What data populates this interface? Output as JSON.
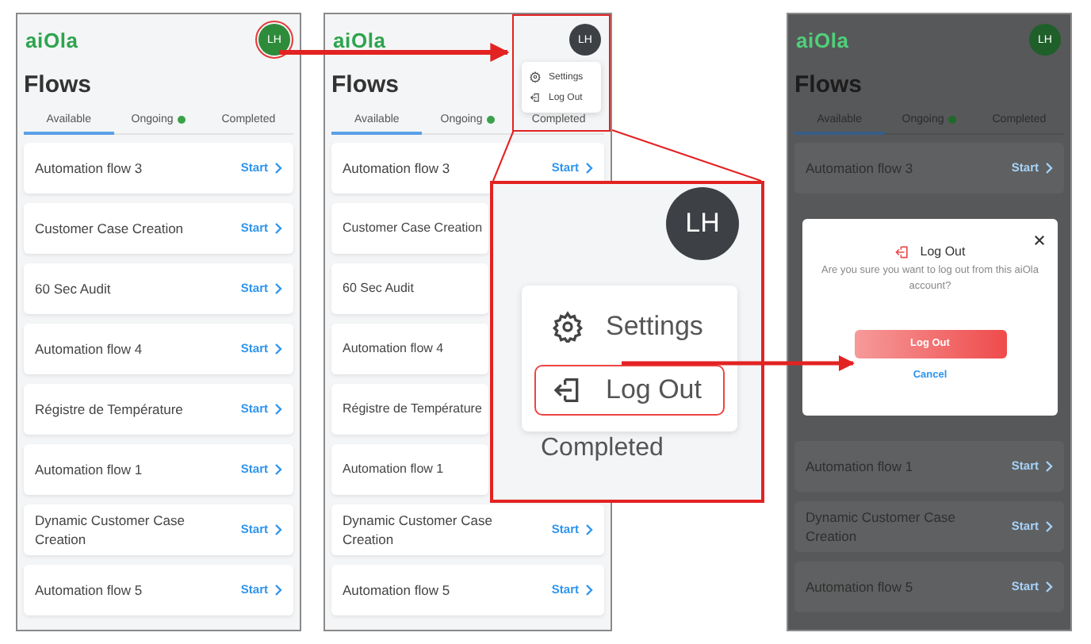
{
  "screens": [
    {
      "logo": "aiOla",
      "avatar": {
        "initials": "LH",
        "color": "#2e8b3a",
        "highlighted": true
      },
      "title": "Flows",
      "tabs": [
        {
          "label": "Available",
          "selected": true,
          "indicator": false
        },
        {
          "label": "Ongoing",
          "selected": false,
          "indicator": true
        },
        {
          "label": "Completed",
          "selected": false,
          "indicator": false
        }
      ],
      "rows": [
        {
          "name": "Automation flow 3",
          "action": "Start"
        },
        {
          "name": "Customer Case Creation",
          "action": "Start"
        },
        {
          "name": "60 Sec Audit",
          "action": "Start"
        },
        {
          "name": "Automation flow 4",
          "action": "Start"
        },
        {
          "name": "Régistre de Température",
          "action": "Start"
        },
        {
          "name": "Automation flow 1",
          "action": "Start"
        },
        {
          "name": "Dynamic Customer Case Creation",
          "action": "Start"
        },
        {
          "name": "Automation flow 5",
          "action": "Start"
        }
      ]
    },
    {
      "logo": "aiOla",
      "avatar": {
        "initials": "LH",
        "color": "#3d4146",
        "highlighted": false
      },
      "title": "Flows",
      "highlight_box": true,
      "menu": [
        {
          "kind": "settings",
          "label": "Settings"
        },
        {
          "kind": "logout",
          "label": "Log Out"
        }
      ],
      "tabs": [
        {
          "label": "Available",
          "selected": true,
          "indicator": false
        },
        {
          "label": "Ongoing",
          "selected": false,
          "indicator": true
        },
        {
          "label": "Completed",
          "selected": false,
          "indicator": false
        }
      ],
      "rows": [
        {
          "name": "Automation flow 3",
          "action": "Start"
        },
        {
          "name": "Customer Case Creation"
        },
        {
          "name": "60 Sec Audit"
        },
        {
          "name": "Automation flow 4"
        },
        {
          "name": "Régistre de Température"
        },
        {
          "name": "Automation flow 1"
        },
        {
          "name": "Dynamic Customer Case Creation",
          "action": "Start"
        },
        {
          "name": "Automation flow 5",
          "action": "Start"
        }
      ]
    },
    {
      "logo": "aiOla",
      "avatar": {
        "initials": "LH",
        "color": "#1f5f2a",
        "highlighted": false
      },
      "title": "Flows",
      "dimmed": true,
      "tabs": [
        {
          "label": "Available",
          "selected": true,
          "indicator": false
        },
        {
          "label": "Ongoing",
          "selected": false,
          "indicator": true
        },
        {
          "label": "Completed",
          "selected": false,
          "indicator": false
        }
      ],
      "rows": [
        {
          "name": "Automation flow 3",
          "action": "Start"
        }
      ],
      "dialog": {
        "title": "Log Out",
        "message": "Are you sure you want to log out from this aiOla account?",
        "confirm": "Log Out",
        "cancel": "Cancel"
      },
      "more_rows": [
        {
          "name": "Automation flow 1",
          "action": "Start"
        },
        {
          "name": "Dynamic Customer Case Creation",
          "action": "Start"
        },
        {
          "name": "Automation flow 5",
          "action": "Start"
        }
      ]
    }
  ],
  "callout": {
    "avatar": "LH",
    "menu": [
      {
        "kind": "settings",
        "label": "Settings",
        "highlighted": false
      },
      {
        "kind": "logout",
        "label": "Log Out",
        "highlighted": true
      }
    ],
    "tab": "Completed"
  }
}
